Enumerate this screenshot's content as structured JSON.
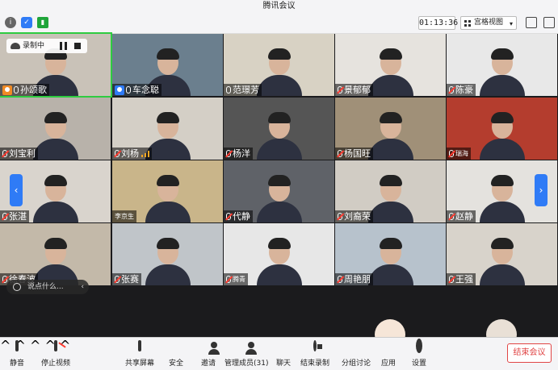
{
  "window": {
    "title": "腾讯会议"
  },
  "toolbar": {
    "timer": "01:13:36",
    "view_label": "宫格视图",
    "view_caret": "▾"
  },
  "recording": {
    "label": "录制中"
  },
  "chat_input": {
    "placeholder": "说点什么..."
  },
  "colors": {
    "accent": "#2f7bf6",
    "end": "#e04545",
    "host": "#f08a24"
  },
  "participants": [
    {
      "name": "孙颂歌",
      "badge": "host",
      "mic": "on"
    },
    {
      "name": "车念聪",
      "badge": "cohost",
      "mic": "on"
    },
    {
      "name": "范璟芳",
      "mic": "on"
    },
    {
      "name": "景郁郁",
      "mic": "muted"
    },
    {
      "name": "陈豪",
      "mic": "muted"
    },
    {
      "name": "刘宝利",
      "mic": "muted"
    },
    {
      "name": "刘杨",
      "mic": "muted",
      "signal": true
    },
    {
      "name": "杨洋",
      "mic": "muted"
    },
    {
      "name": "杨国旺",
      "mic": "muted"
    },
    {
      "name": "瑞海",
      "mic": "muted",
      "small": true
    },
    {
      "name": "张湛",
      "mic": "muted"
    },
    {
      "name": "李京生",
      "mic": "none",
      "small": true
    },
    {
      "name": "代静",
      "mic": "muted"
    },
    {
      "name": "刘裔荣",
      "mic": "muted"
    },
    {
      "name": "赵静",
      "mic": "muted"
    },
    {
      "name": "徐春波",
      "mic": "muted"
    },
    {
      "name": "张赛",
      "mic": "muted"
    },
    {
      "name": "腾青",
      "mic": "muted",
      "small": true
    },
    {
      "name": "周艳朋",
      "mic": "muted"
    },
    {
      "name": "王强",
      "mic": "muted"
    }
  ],
  "bottombar": {
    "mute": "静音",
    "stop_video": "停止视频",
    "share_screen": "共享屏幕",
    "security": "安全",
    "invite": "邀请",
    "members": "管理成员(31)",
    "chat": "聊天",
    "end_record": "结束录制",
    "breakout": "分组讨论",
    "apps": "应用",
    "settings": "设置",
    "end_meeting": "结束会议"
  }
}
